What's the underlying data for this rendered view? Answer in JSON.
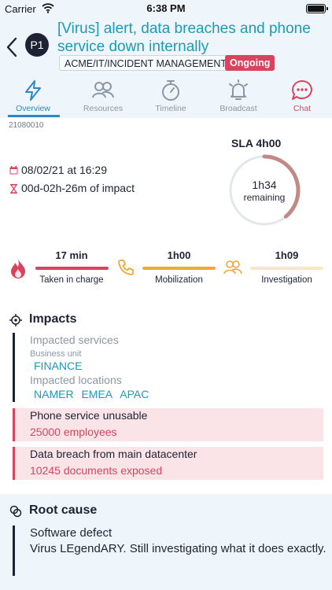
{
  "status_bar": {
    "carrier": "Carrier",
    "time": "6:38 PM"
  },
  "incident": {
    "priority": "P1",
    "title": "[Virus] alert, data breaches and phone service down internally",
    "category": "ACME/IT/INCIDENT MANAGEMENT",
    "status": "Ongoing",
    "id": "21080010"
  },
  "tabs": [
    {
      "label": "Overview",
      "icon": "lightning-icon"
    },
    {
      "label": "Resources",
      "icon": "people-icon"
    },
    {
      "label": "Timeline",
      "icon": "stopwatch-icon"
    },
    {
      "label": "Broadcast",
      "icon": "bell-icon"
    },
    {
      "label": "Chat",
      "icon": "chat-bubble-icon"
    }
  ],
  "sla": {
    "label": "SLA 4h00",
    "remaining_value": "1h34",
    "remaining_label": "remaining",
    "remaining_fraction": 0.39
  },
  "start_date": "08/02/21 at 16:29",
  "impact_duration": "00d-02h-26m of impact",
  "steps": [
    {
      "value": "17 min",
      "label": "Taken in charge",
      "color": "#d9435e",
      "icon": "flame-icon"
    },
    {
      "value": "1h00",
      "label": "Mobilization",
      "color": "#f0a830",
      "icon": "phone-icon"
    },
    {
      "value": "1h09",
      "label": "Investigation",
      "color": "#fbe6c4",
      "icon": "people-icon"
    }
  ],
  "impacts": {
    "title": "Impacts",
    "services_heading": "Impacted services",
    "business_unit_label": "Business unit",
    "business_units": [
      "FINANCE"
    ],
    "locations_heading": "Impacted locations",
    "locations": [
      "NAMER",
      "EMEA",
      "APAC"
    ],
    "items": [
      {
        "title": "Phone service unusable",
        "detail": "25000 employees"
      },
      {
        "title": "Data breach from main datacenter",
        "detail": "10245 documents exposed"
      }
    ]
  },
  "root_cause": {
    "title": "Root cause",
    "text_line1": "Software defect",
    "text_line2": "Virus LEgendARY. Still investigating what it does exactly."
  },
  "colors": {
    "accent": "#1a9bb6",
    "active_tab": "#2e87c9",
    "alert": "#d9435e",
    "header_bg": "#eef6fb",
    "sla_ring": "#c28a86"
  }
}
